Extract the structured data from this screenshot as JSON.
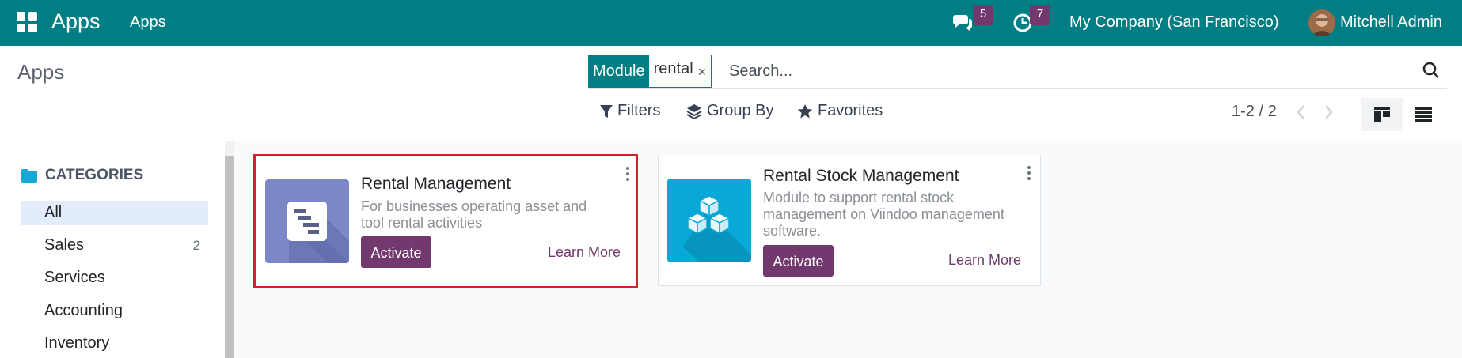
{
  "navbar": {
    "brand": "Apps",
    "menu_item": "Apps",
    "messages_count": "5",
    "activities_count": "7",
    "company": "My Company (San Francisco)",
    "user": "Mitchell Admin",
    "accent_color": "#017e84",
    "badge_color": "#71396e"
  },
  "control_panel": {
    "title": "Apps",
    "search": {
      "facet_label": "Module",
      "facet_value": "rental",
      "facet_close": "×",
      "placeholder": "Search..."
    },
    "filters_label": "Filters",
    "group_by_label": "Group By",
    "favorites_label": "Favorites",
    "pager": "1-2 / 2",
    "active_view": "kanban"
  },
  "sidebar": {
    "header": "CATEGORIES",
    "items": [
      {
        "label": "All",
        "count": "",
        "active": true
      },
      {
        "label": "Sales",
        "count": "2",
        "active": false
      },
      {
        "label": "Services",
        "count": "",
        "active": false
      },
      {
        "label": "Accounting",
        "count": "",
        "active": false
      },
      {
        "label": "Inventory",
        "count": "",
        "active": false
      }
    ]
  },
  "cards": [
    {
      "title": "Rental Management",
      "description_line1": "For businesses operating asset and",
      "description_line2": "tool rental activities",
      "description_line3": "",
      "activate_label": "Activate",
      "learn_more_label": "Learn More",
      "icon": "rental-management-icon",
      "icon_color": "#7c87c8",
      "highlighted": true
    },
    {
      "title": "Rental Stock Management",
      "description_line1": "Module to support rental stock",
      "description_line2": "management on Viindoo management",
      "description_line3": "software.",
      "activate_label": "Activate",
      "learn_more_label": "Learn More",
      "icon": "cubes-icon",
      "icon_color": "#08a9d6",
      "highlighted": false
    }
  ]
}
